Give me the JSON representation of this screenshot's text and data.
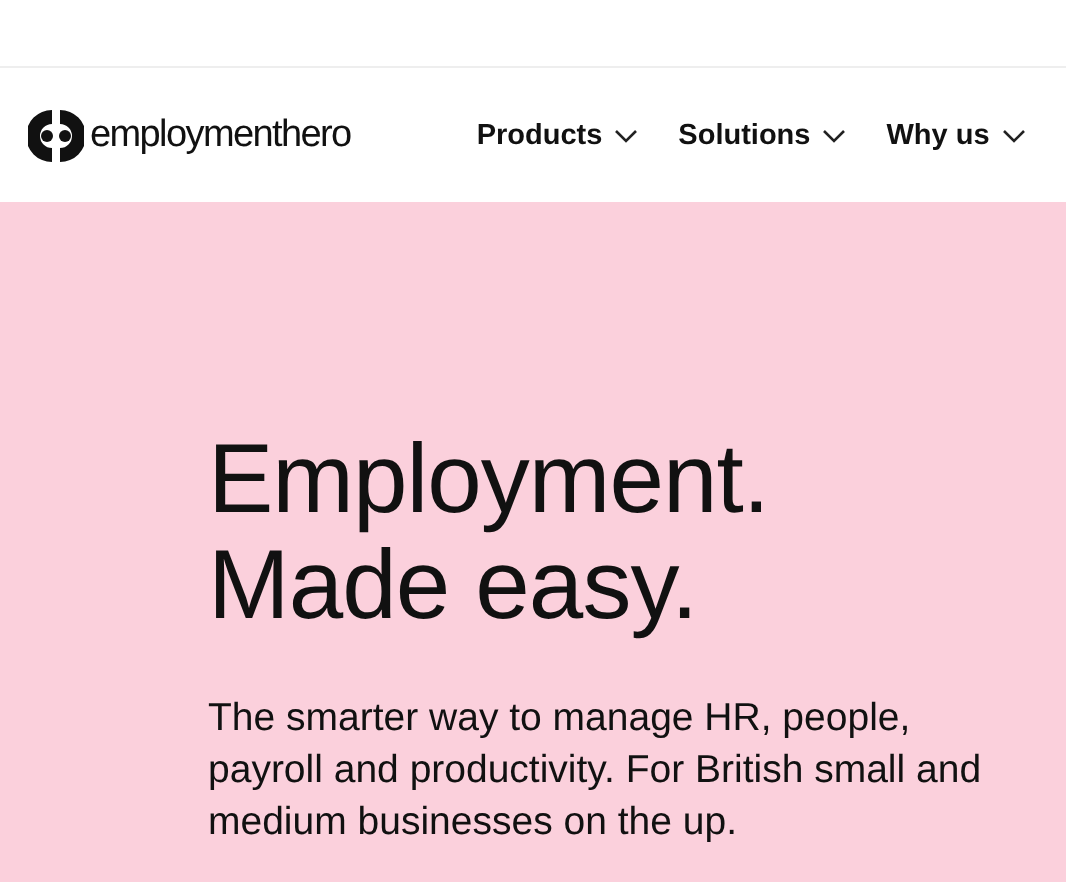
{
  "header": {
    "logo_text": "employmenthero",
    "nav": [
      {
        "label": "Products",
        "expanded": false
      },
      {
        "label": "Solutions",
        "expanded": false
      },
      {
        "label": "Why us",
        "expanded": false
      }
    ]
  },
  "hero": {
    "title_lines": [
      "Employment.",
      "Made easy."
    ],
    "subtitle": "The smarter way to manage HR, people, payroll and productivity. For British small and medium businesses on the up."
  }
}
